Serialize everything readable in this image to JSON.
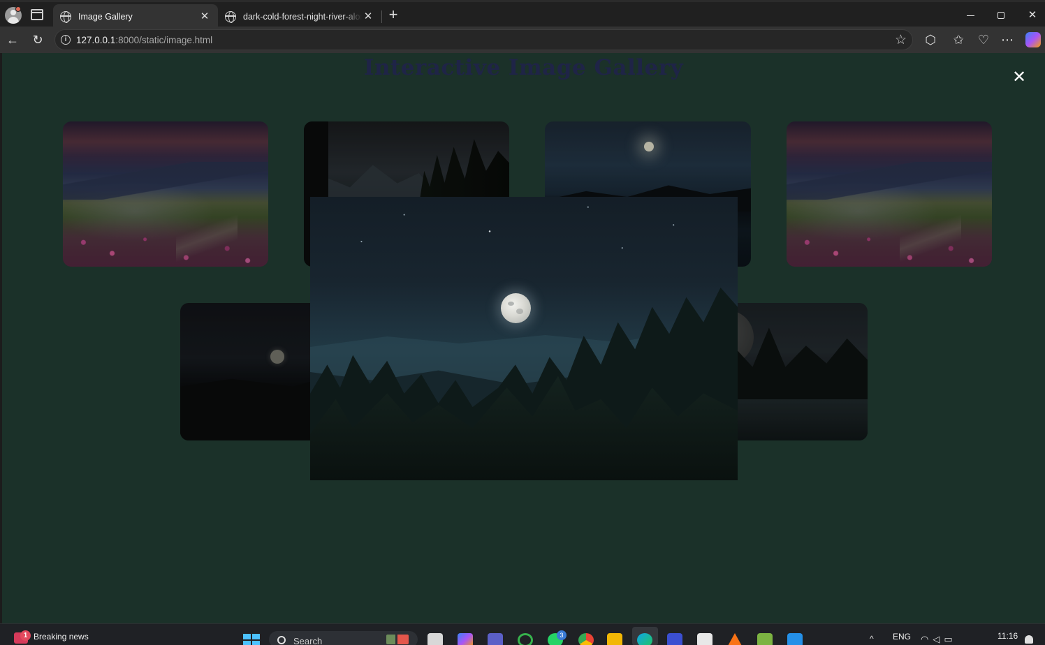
{
  "browser": {
    "tabs": [
      {
        "title": "Image Gallery",
        "active": true
      },
      {
        "title": "dark-cold-forest-night-river-alone",
        "active": false
      }
    ],
    "url_host": "127.0.0.1",
    "url_rest": ":8000/static/image.html",
    "info_glyph": "i"
  },
  "page": {
    "title": "Interactive Image Gallery",
    "close_glyph": "✕",
    "thumbnails": [
      {
        "icon": "meadow-sunset-image"
      },
      {
        "icon": "forest-lake-image"
      },
      {
        "icon": "moonlit-lake-dock-image"
      },
      {
        "icon": "meadow-sunset-image"
      },
      {
        "icon": "dark-moon-hills-image"
      },
      {
        "icon": "pines-full-moon-image"
      }
    ],
    "lightbox_image": "moonlit-forest-image"
  },
  "taskbar": {
    "news_label": "Breaking news",
    "news_sub": "...",
    "news_badge": "1",
    "search_placeholder": "Search",
    "app_badge": "3",
    "language": "ENG",
    "time": "11:16"
  },
  "colors": {
    "page_background": "#1b3129",
    "title": "#1f2447",
    "accent": "#4cc2ff"
  }
}
